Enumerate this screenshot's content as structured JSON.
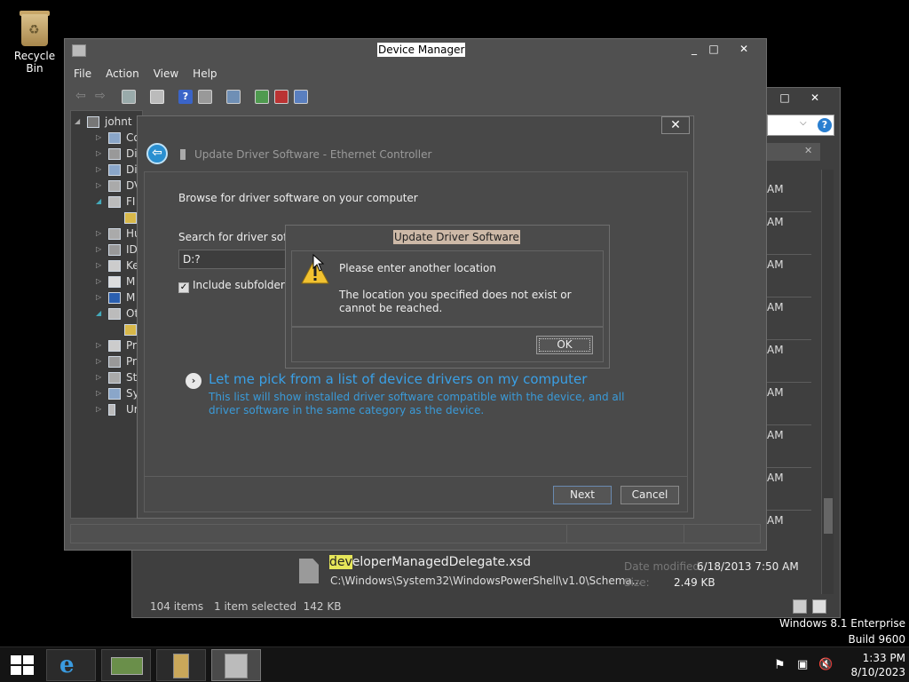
{
  "desktop": {
    "recycle_bin_label": "Recycle Bin",
    "os_name": "Windows 8.1 Enterprise",
    "build": "Build 9600"
  },
  "explorer": {
    "row_time": "AM",
    "file_name": "developerManagedDelegate.xsd",
    "file_name_highlight": "dev",
    "file_name_rest": "eloperManagedDelegate.xsd",
    "file_path": "C:\\Windows\\System32\\WindowsPowerShell\\v1.0\\Schema...",
    "date_label": "Date modified:",
    "date_value": "6/18/2013 7:50 AM",
    "size_label": "Size:",
    "size_value": "2.49 KB",
    "items_count": "104 items",
    "selected_info": "1 item selected  142 KB",
    "help_icon": "help-icon"
  },
  "device_manager": {
    "title": "Device Manager",
    "menu": [
      "File",
      "Action",
      "View",
      "Help"
    ],
    "tree_root": "johnt",
    "tree_items": [
      "Co",
      "Di",
      "Di",
      "DV",
      "FI",
      "Hu",
      "ID",
      "Ke",
      "M",
      "M",
      "Ot",
      "Pr",
      "Pr",
      "St",
      "Sy",
      "Ur"
    ]
  },
  "wizard": {
    "title": "Update Driver Software - Ethernet Controller",
    "heading": "Browse for driver software on your computer",
    "search_label": "Search for driver software in this location:",
    "path_value": "D:?",
    "include_subfolders": "Include subfolders",
    "pick_title": "Let me pick from a list of device drivers on my computer",
    "pick_desc": "This list will show installed driver software compatible with the device, and all driver software in the same category as the device.",
    "next_label": "Next",
    "cancel_label": "Cancel"
  },
  "message_box": {
    "title": "Update Driver Software",
    "message1": "Please enter another location",
    "message2": "The location you specified does not exist or cannot be reached.",
    "ok_label": "OK"
  },
  "taskbar": {
    "time": "1:33 PM",
    "date": "8/10/2023"
  },
  "colors": {
    "link": "#3aa0e6",
    "accent": "#2a8fd0"
  }
}
